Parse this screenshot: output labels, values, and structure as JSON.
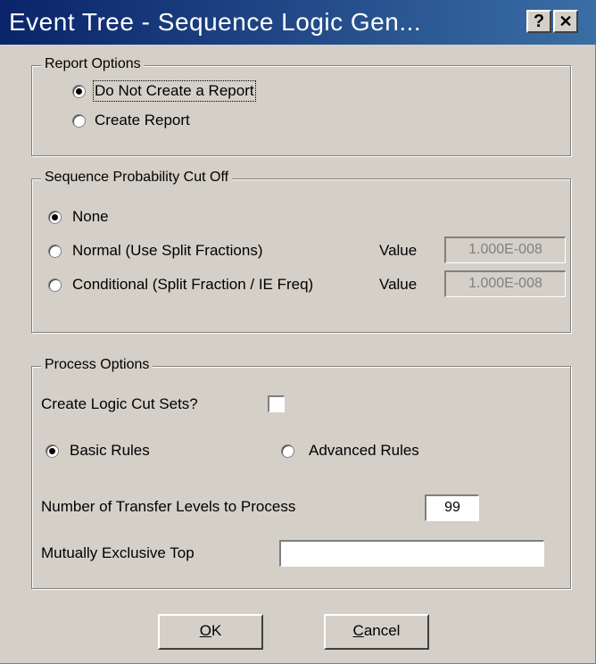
{
  "window": {
    "title": "Event Tree - Sequence Logic Gen...",
    "help_button": "?",
    "close_button": "✕"
  },
  "report_options": {
    "legend": "Report Options",
    "options": [
      {
        "label": "Do Not Create a Report",
        "selected": true
      },
      {
        "label": "Create Report",
        "selected": false
      }
    ]
  },
  "cutoff": {
    "legend": "Sequence Probability Cut Off",
    "options": [
      {
        "label": "None",
        "selected": true
      },
      {
        "label": "Normal (Use Split Fractions)",
        "selected": false
      },
      {
        "label": "Conditional (Split Fraction / IE Freq)",
        "selected": false
      }
    ],
    "value_label": "Value",
    "normal_value": "1.000E-008",
    "conditional_value": "1.000E-008"
  },
  "process": {
    "legend": "Process Options",
    "cut_sets_label": "Create Logic Cut Sets?",
    "cut_sets_checked": false,
    "rules": [
      {
        "label": "Basic Rules",
        "selected": true
      },
      {
        "label": "Advanced Rules",
        "selected": false
      }
    ],
    "transfer_label": "Number of Transfer Levels to Process",
    "transfer_value": "99",
    "mutex_label": "Mutually Exclusive Top",
    "mutex_value": ""
  },
  "buttons": {
    "ok_mnemonic": "O",
    "ok_rest": "K",
    "cancel_mnemonic": "C",
    "cancel_rest": "ancel"
  }
}
